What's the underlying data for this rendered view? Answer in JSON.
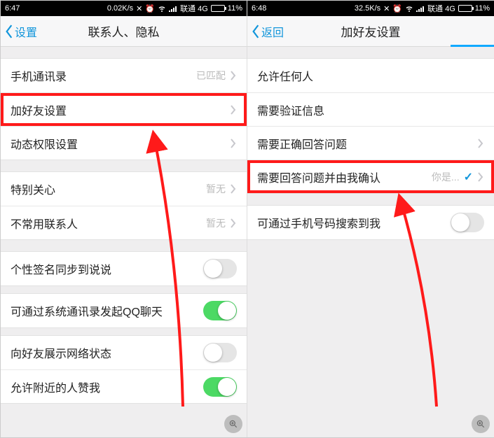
{
  "left": {
    "status": {
      "time": "6:47",
      "speed": "0.02K/s",
      "carrier": "联通 4G",
      "battery": "11%"
    },
    "nav": {
      "back": "设置",
      "title": "联系人、隐私"
    },
    "rows": {
      "contacts": {
        "label": "手机通讯录",
        "note": "已匹配"
      },
      "addFriend": {
        "label": "加好友设置"
      },
      "moments": {
        "label": "动态权限设置"
      },
      "special": {
        "label": "特别关心",
        "note": "暂无"
      },
      "infrequent": {
        "label": "不常用联系人",
        "note": "暂无"
      },
      "signature": {
        "label": "个性签名同步到说说"
      },
      "qqchat": {
        "label": "可通过系统通讯录发起QQ聊天"
      },
      "netstatus": {
        "label": "向好友展示网络状态"
      },
      "nearby": {
        "label": "允许附近的人赞我"
      }
    }
  },
  "right": {
    "status": {
      "time": "6:48",
      "speed": "32.5K/s",
      "carrier": "联通 4G",
      "battery": "11%"
    },
    "nav": {
      "back": "返回",
      "title": "加好友设置"
    },
    "rows": {
      "anyone": {
        "label": "允许任何人"
      },
      "verify": {
        "label": "需要验证信息"
      },
      "answer": {
        "label": "需要正确回答问题"
      },
      "confirm": {
        "label": "需要回答问题并由我确认",
        "hint": "你是..."
      },
      "searchPhone": {
        "label": "可通过手机号码搜索到我"
      }
    }
  }
}
